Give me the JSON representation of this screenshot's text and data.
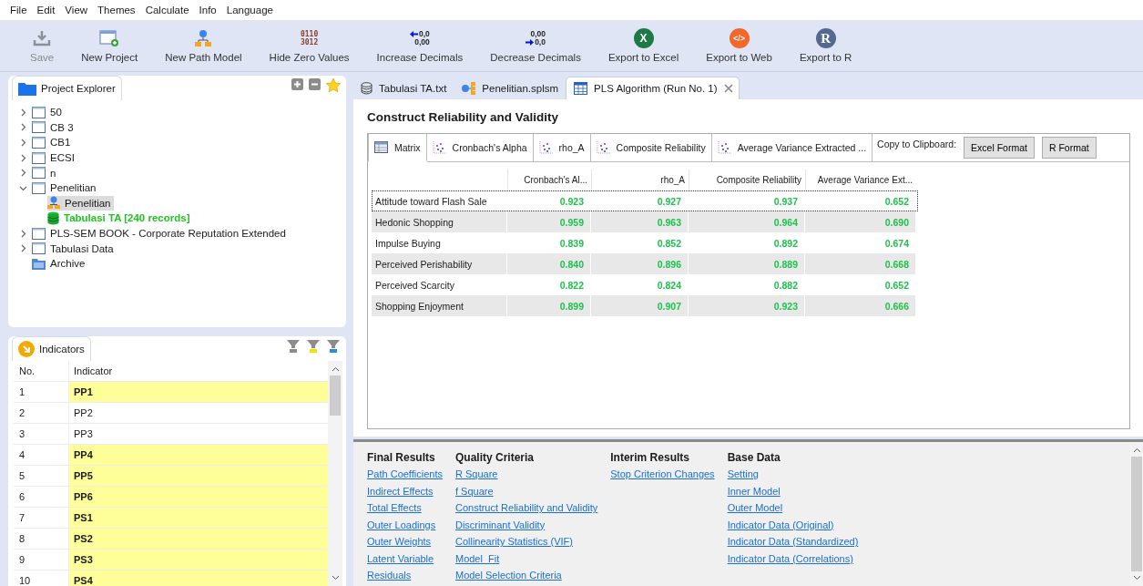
{
  "menu": [
    "File",
    "Edit",
    "View",
    "Themes",
    "Calculate",
    "Info",
    "Language"
  ],
  "toolbar": [
    {
      "kind": "save",
      "label": "Save",
      "disabled": true
    },
    {
      "kind": "new_project",
      "label": "New Project",
      "disabled": false
    },
    {
      "kind": "path_model",
      "label": "New Path Model",
      "disabled": false
    },
    {
      "kind": "zeros",
      "label": "Hide Zero Values",
      "disabled": false,
      "icon_lines": [
        "0110",
        "3012"
      ]
    },
    {
      "kind": "increase",
      "label": "Increase Decimals",
      "disabled": false,
      "icon_lines": [
        "0,0",
        "0,00"
      ]
    },
    {
      "kind": "decrease",
      "label": "Decrease Decimals",
      "disabled": false,
      "icon_lines": [
        "0,00",
        "0,0"
      ]
    },
    {
      "kind": "excel",
      "label": "Export to Excel",
      "disabled": false,
      "glyph": "X"
    },
    {
      "kind": "web",
      "label": "Export to Web",
      "disabled": false,
      "glyph": "</>"
    },
    {
      "kind": "r",
      "label": "Export to R",
      "disabled": false,
      "glyph": "R"
    }
  ],
  "project_explorer": {
    "title": "Project Explorer",
    "items": [
      {
        "kind": "project",
        "label": "50",
        "expanded": false
      },
      {
        "kind": "project",
        "label": "CB 3",
        "expanded": false
      },
      {
        "kind": "project",
        "label": "CB1",
        "expanded": false
      },
      {
        "kind": "project",
        "label": "ECSI",
        "expanded": false
      },
      {
        "kind": "project",
        "label": "n",
        "expanded": false
      },
      {
        "kind": "project",
        "label": "Penelitian",
        "expanded": true,
        "children": [
          {
            "kind": "model",
            "label": "Penelitian",
            "selected": true
          },
          {
            "kind": "data",
            "label": "Tabulasi TA [240 records]",
            "selected": false
          }
        ]
      },
      {
        "kind": "project",
        "label": "PLS-SEM BOOK - Corporate Reputation Extended",
        "expanded": false
      },
      {
        "kind": "project",
        "label": "Tabulasi Data",
        "expanded": false
      },
      {
        "kind": "archive",
        "label": "Archive"
      }
    ]
  },
  "indicators": {
    "title": "Indicators",
    "columns": [
      "No.",
      "Indicator"
    ],
    "rows": [
      {
        "no": "1",
        "name": "PP1",
        "selected": true
      },
      {
        "no": "2",
        "name": "PP2",
        "selected": false
      },
      {
        "no": "3",
        "name": "PP3",
        "selected": false
      },
      {
        "no": "4",
        "name": "PP4",
        "selected": true
      },
      {
        "no": "5",
        "name": "PP5",
        "selected": true
      },
      {
        "no": "6",
        "name": "PP6",
        "selected": true
      },
      {
        "no": "7",
        "name": "PS1",
        "selected": true
      },
      {
        "no": "8",
        "name": "PS2",
        "selected": true
      },
      {
        "no": "9",
        "name": "PS3",
        "selected": true
      },
      {
        "no": "10",
        "name": "PS4",
        "selected": true
      }
    ]
  },
  "editor_tabs": [
    {
      "kind": "data",
      "label": "Tabulasi TA.txt",
      "selected": false
    },
    {
      "kind": "model",
      "label": "Penelitian.splsm",
      "selected": false
    },
    {
      "kind": "report",
      "label": "PLS Algorithm (Run No. 1)",
      "selected": true
    }
  ],
  "report": {
    "title": "Construct Reliability and Validity",
    "tabs": [
      {
        "kind": "matrix",
        "label": "Matrix",
        "selected": true
      },
      {
        "kind": "chart",
        "label": "Cronbach's Alpha",
        "selected": false
      },
      {
        "kind": "chart",
        "label": "rho_A",
        "selected": false
      },
      {
        "kind": "chart",
        "label": "Composite Reliability",
        "selected": false
      },
      {
        "kind": "chart",
        "label": "Average Variance Extracted ...",
        "selected": false
      }
    ],
    "clipboard_label": "Copy to Clipboard:",
    "clipboard_buttons": [
      "Excel Format",
      "R Format"
    ],
    "columns": [
      "Cronbach's Al...",
      "rho_A",
      "Composite Reliability",
      "Average Variance Ext..."
    ],
    "rows": [
      {
        "name": "Attitude toward Flash Sale",
        "values": [
          "0.923",
          "0.927",
          "0.937",
          "0.652"
        ],
        "focused": true
      },
      {
        "name": "Hedonic Shopping",
        "values": [
          "0.959",
          "0.963",
          "0.964",
          "0.690"
        ],
        "focused": false
      },
      {
        "name": "Impulse Buying",
        "values": [
          "0.839",
          "0.852",
          "0.892",
          "0.674"
        ],
        "focused": false
      },
      {
        "name": "Perceived Perishability",
        "values": [
          "0.840",
          "0.896",
          "0.889",
          "0.668"
        ],
        "focused": false
      },
      {
        "name": "Perceived Scarcity",
        "values": [
          "0.822",
          "0.824",
          "0.882",
          "0.652"
        ],
        "focused": false
      },
      {
        "name": "Shopping Enjoyment",
        "values": [
          "0.899",
          "0.907",
          "0.923",
          "0.666"
        ],
        "focused": false
      }
    ]
  },
  "navigation": [
    {
      "heading": "Final Results",
      "links": [
        "Path Coefficients",
        "Indirect Effects",
        "Total Effects",
        "Outer Loadings",
        "Outer Weights",
        "Latent Variable",
        "Residuals"
      ]
    },
    {
      "heading": "Quality Criteria",
      "links": [
        "R Square",
        "f Square",
        "Construct Reliability and Validity",
        "Discriminant Validity",
        "Collinearity Statistics (VIF)",
        "Model_Fit",
        "Model Selection Criteria"
      ]
    },
    {
      "heading": "Interim Results",
      "links": [
        "Stop Criterion Changes"
      ]
    },
    {
      "heading": "Base Data",
      "links": [
        "Setting",
        "Inner Model",
        "Outer Model",
        "Indicator Data (Original)",
        "Indicator Data (Standardized)",
        "Indicator Data (Correlations)"
      ]
    }
  ]
}
